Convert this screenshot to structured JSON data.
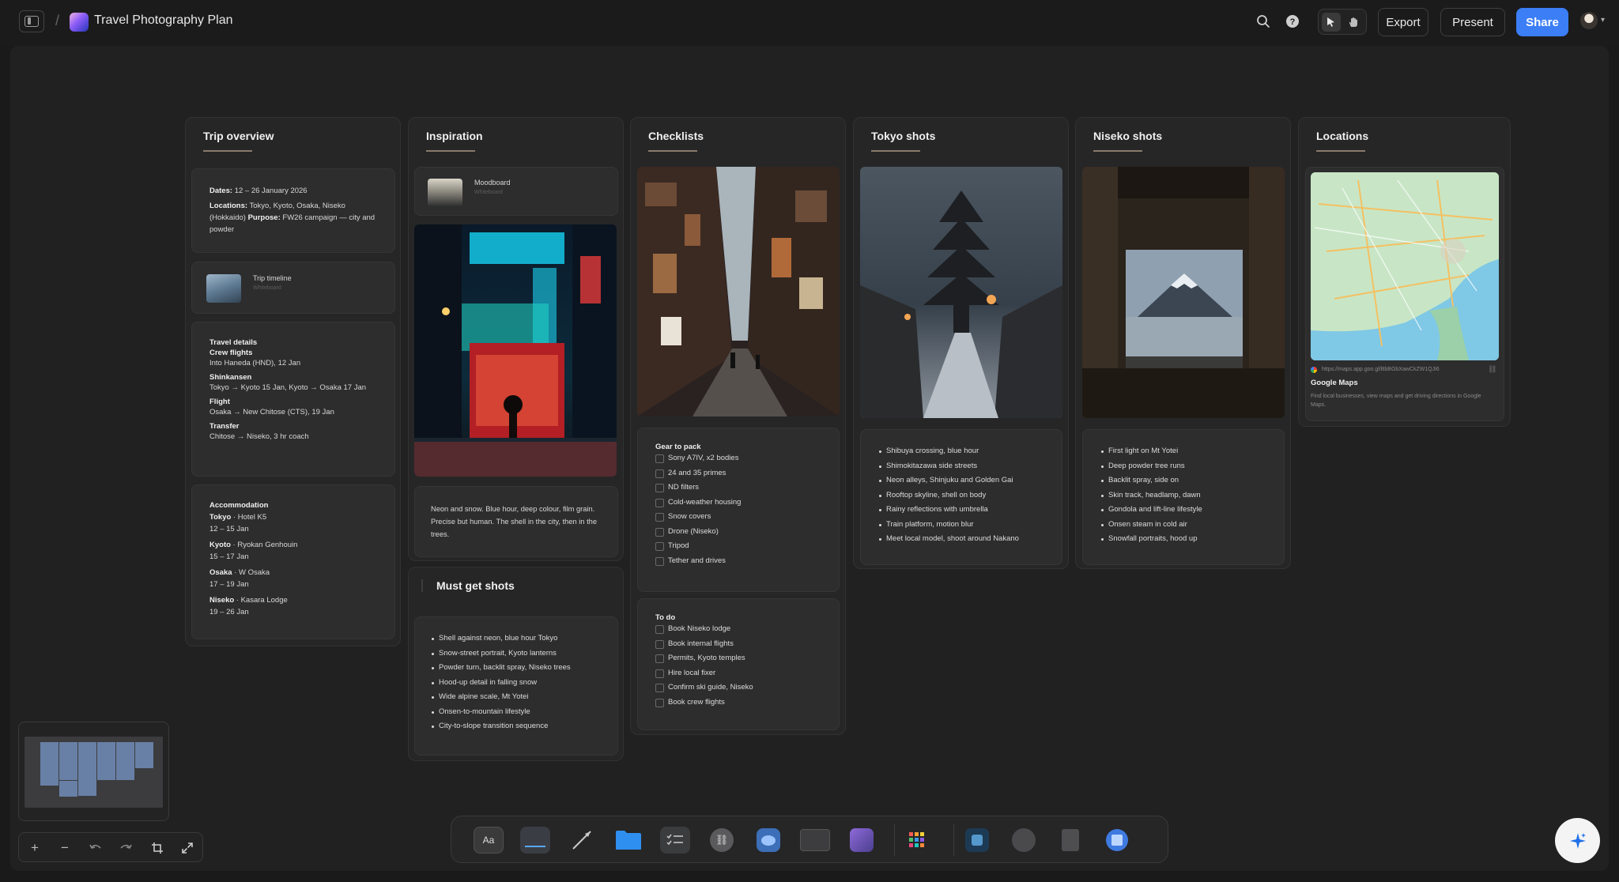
{
  "header": {
    "title": "Travel Photography Plan",
    "export_label": "Export",
    "present_label": "Present",
    "share_label": "Share"
  },
  "columns": {
    "trip": {
      "title": "Trip overview",
      "overview": {
        "dates_label": "Dates:",
        "dates_value": "12 – 26 January 2026",
        "locations_label": "Locations:",
        "locations_value": "Tokyo, Kyoto, Osaka, Niseko (Hokkaido)",
        "purpose_label": "Purpose:",
        "purpose_value": "FW26 campaign — city and powder"
      },
      "timeline": {
        "title": "Trip timeline",
        "subtitle": "Whiteboard"
      },
      "travel": {
        "heading": "Travel details",
        "items": [
          {
            "label": "Crew flights",
            "value": "Into Haneda (HND), 12 Jan"
          },
          {
            "label": "Shinkansen",
            "value": "Tokyo → Kyoto 15 Jan, Kyoto → Osaka 17 Jan"
          },
          {
            "label": "Flight",
            "value": "Osaka → New Chitose (CTS), 19 Jan"
          },
          {
            "label": "Transfer",
            "value": "Chitose → Niseko, 3 hr coach"
          }
        ]
      },
      "accommodation": {
        "heading": "Accommodation",
        "items": [
          {
            "city": "Tokyo",
            "place": " · Hotel K5",
            "dates": "12 – 15 Jan"
          },
          {
            "city": "Kyoto",
            "place": " · Ryokan Genhouin",
            "dates": "15 – 17 Jan"
          },
          {
            "city": "Osaka",
            "place": " · W Osaka",
            "dates": "17 – 19 Jan"
          },
          {
            "city": "Niseko",
            "place": " · Kasara Lodge",
            "dates": "19 – 26 Jan"
          }
        ]
      }
    },
    "inspiration": {
      "title": "Inspiration",
      "moodboard": {
        "title": "Moodboard",
        "subtitle": "Whiteboard"
      },
      "note": "Neon and snow. Blue hour, deep colour, film grain. Precise but human. The shell in the city, then in the trees."
    },
    "must": {
      "title": "Must get shots",
      "items": [
        "Shell against neon, blue hour Tokyo",
        "Snow-street portrait, Kyoto lanterns",
        "Powder turn, backlit spray, Niseko trees",
        "Hood-up detail in falling snow",
        "Wide alpine scale, Mt Yotei",
        "Onsen-to-mountain lifestyle",
        "City-to-slope transition sequence"
      ]
    },
    "checklists": {
      "title": "Checklists",
      "gear": {
        "heading": "Gear to pack",
        "items": [
          "Sony A7IV, x2 bodies",
          "24 and 35 primes",
          "ND filters",
          "Cold-weather housing",
          "Snow covers",
          "Drone (Niseko)",
          "Tripod",
          "Tether and drives"
        ]
      },
      "todo": {
        "heading": "To do",
        "items": [
          "Book Niseko lodge",
          "Book internal flights",
          "Permits, Kyoto temples",
          "Hire local fixer",
          "Confirm ski guide, Niseko",
          "Book crew flights"
        ]
      }
    },
    "tokyo": {
      "title": "Tokyo shots",
      "items": [
        "Shibuya crossing, blue hour",
        "Shimokitazawa side streets",
        "Neon alleys, Shinjuku and Golden Gai",
        "Rooftop skyline, shell on body",
        "Rainy reflections with umbrella",
        "Train platform, motion blur",
        "Meet local model, shoot around Nakano"
      ]
    },
    "niseko": {
      "title": "Niseko shots",
      "items": [
        "First light on Mt Yotei",
        "Deep powder tree runs",
        "Backlit spray, side on",
        "Skin track, headlamp, dawn",
        "Gondola and lift-line lifestyle",
        "Onsen steam in cold air",
        "Snowfall portraits, hood up"
      ]
    },
    "locations": {
      "title": "Locations",
      "link": {
        "url": "https://maps.app.goo.gl/BbBGbXawCkZW1QJi6",
        "title": "Google Maps",
        "description": "Find local businesses, view maps and get driving directions in Google Maps."
      }
    }
  },
  "icons": [
    "sidebar-toggle-icon",
    "search-icon",
    "help-icon",
    "pointer-icon",
    "hand-icon",
    "zoom-in-icon",
    "zoom-out-icon",
    "undo-icon",
    "redo-icon",
    "fit-icon",
    "fullscreen-icon",
    "sparkle-icon"
  ],
  "colors": {
    "accent": "#3b7ef6",
    "canvas": "#212122",
    "column": "#262627",
    "card": "#2d2d2e"
  }
}
